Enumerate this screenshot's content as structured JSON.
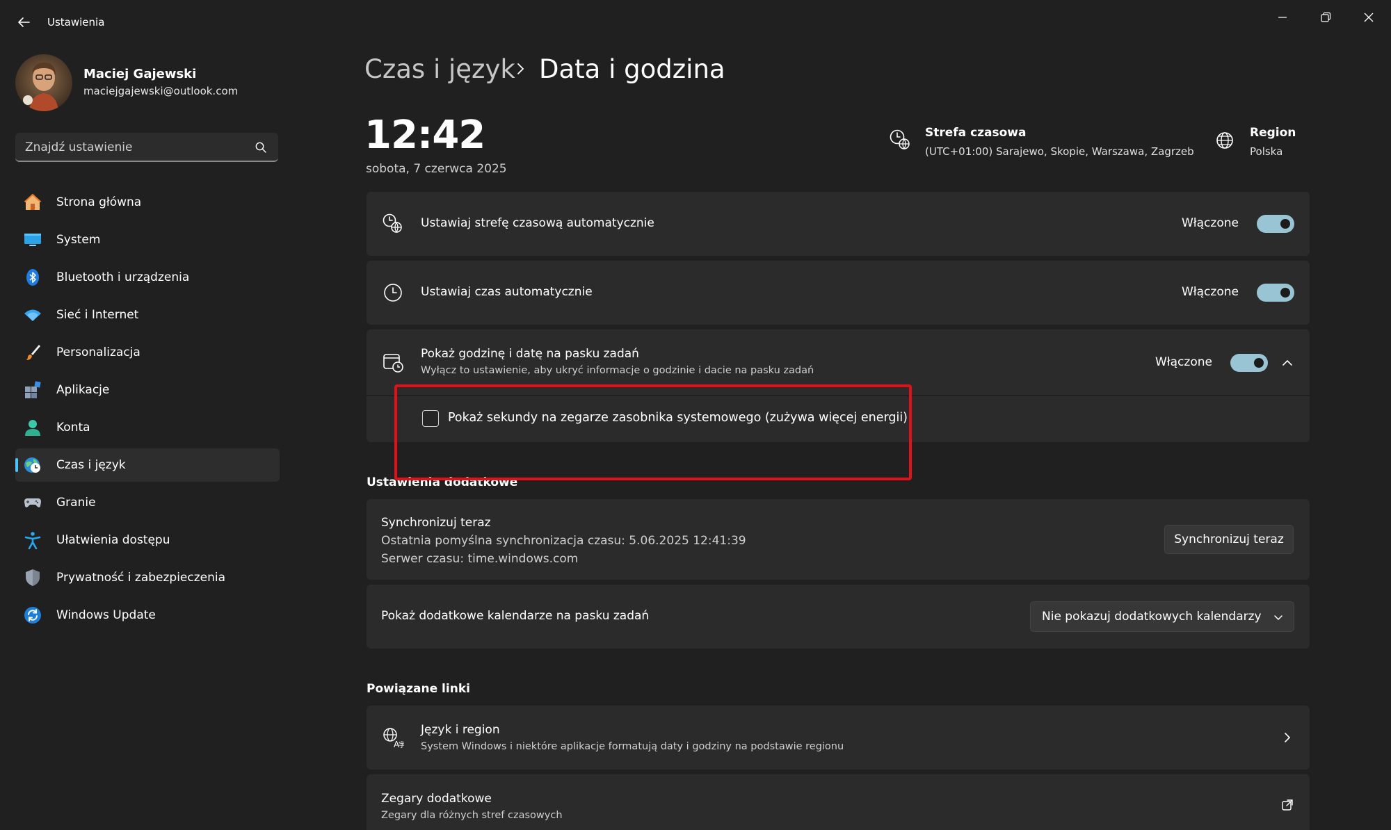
{
  "window": {
    "title": "Ustawienia",
    "controls": [
      "minimize-icon",
      "restore-icon",
      "close-icon"
    ]
  },
  "profile": {
    "name": "Maciej Gajewski",
    "email": "maciejgajewski@outlook.com"
  },
  "search": {
    "placeholder": "Znajdź ustawienie"
  },
  "nav": {
    "items": [
      {
        "label": "Strona główna",
        "icon": "home-icon"
      },
      {
        "label": "System",
        "icon": "monitor-icon"
      },
      {
        "label": "Bluetooth i urządzenia",
        "icon": "bluetooth-icon"
      },
      {
        "label": "Sieć i Internet",
        "icon": "wifi-icon"
      },
      {
        "label": "Personalizacja",
        "icon": "brush-icon"
      },
      {
        "label": "Aplikacje",
        "icon": "apps-icon"
      },
      {
        "label": "Konta",
        "icon": "account-icon"
      },
      {
        "label": "Czas i język",
        "icon": "time-language-icon",
        "selected": true
      },
      {
        "label": "Granie",
        "icon": "gamepad-icon"
      },
      {
        "label": "Ułatwienia dostępu",
        "icon": "accessibility-icon"
      },
      {
        "label": "Prywatność i zabezpieczenia",
        "icon": "shield-icon"
      },
      {
        "label": "Windows Update",
        "icon": "update-icon"
      }
    ]
  },
  "breadcrumb": {
    "parent": "Czas i język",
    "current": "Data i godzina"
  },
  "clock": {
    "time": "12:42",
    "date": "sobota, 7 czerwca 2025"
  },
  "timezone": {
    "title": "Strefa czasowa",
    "value": "(UTC+01:00) Sarajewo, Skopie, Warszawa, Zagrzeb"
  },
  "region": {
    "title": "Region",
    "value": "Polska"
  },
  "settings": {
    "auto_timezone": {
      "label": "Ustawiaj strefę czasową automatycznie",
      "state": "Włączone",
      "on": true
    },
    "auto_time": {
      "label": "Ustawiaj czas automatycznie",
      "state": "Włączone",
      "on": true
    },
    "taskbar_time": {
      "label": "Pokaż godzinę i datę na pasku zadań",
      "sub": "Wyłącz to ustawienie, aby ukryć informacje o godzinie i dacie na pasku zadań",
      "state": "Włączone",
      "on": true,
      "expanded": true
    },
    "show_seconds": {
      "label": "Pokaż sekundy na zegarze zasobnika systemowego (zużywa więcej energii)",
      "checked": false
    }
  },
  "additional": {
    "title": "Ustawienia dodatkowe",
    "sync": {
      "title": "Synchronizuj teraz",
      "last_sync": "Ostatnia pomyślna synchronizacja czasu: 5.06.2025 12:41:39",
      "server": "Serwer czasu: time.windows.com",
      "button": "Synchronizuj teraz"
    },
    "calendars": {
      "label": "Pokaż dodatkowe kalendarze na pasku zadań",
      "selected": "Nie pokazuj dodatkowych kalendarzy"
    }
  },
  "related": {
    "title": "Powiązane linki",
    "language_region": {
      "title": "Język i region",
      "sub": "System Windows i niektóre aplikacje formatują daty i godziny na podstawie regionu"
    },
    "clocks": {
      "title": "Zegary dodatkowe",
      "sub": "Zegary dla różnych stref czasowych"
    }
  },
  "colors": {
    "background": "#202020",
    "card": "#2b2b2b",
    "accent": "#4cc2ff",
    "toggle_on": "#98c4d4",
    "highlight": "#e1111a"
  }
}
